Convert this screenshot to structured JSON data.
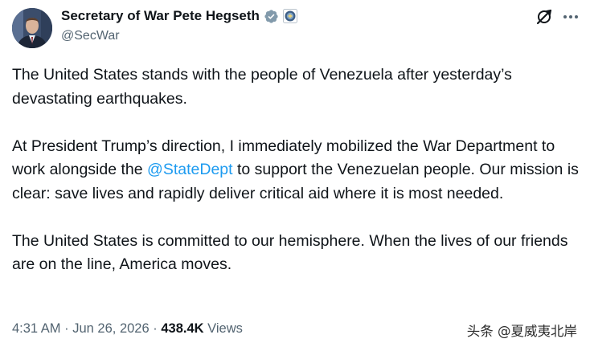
{
  "author": {
    "display_name": "Secretary of War Pete Hegseth",
    "handle": "@SecWar",
    "verified_badge": "gray-checkmark-icon",
    "affiliate_badge": "department-seal-icon"
  },
  "actions": {
    "grok_icon": "grok-icon",
    "more_icon": "more-horizontal-icon"
  },
  "body": {
    "p1": "The United States stands with the people of Venezuela after yesterday’s devastating earthquakes.",
    "p2_before": "At President Trump’s direction, I immediately mobilized the War Department to work alongside the ",
    "p2_mention": "@StateDept",
    "p2_after": " to support the Venezuelan people. Our mission is clear: save lives and rapidly deliver critical aid where it is most needed.",
    "p3": "The United States is committed to our hemisphere. When the lives of our friends are on the line, America moves."
  },
  "meta": {
    "time": "4:31 AM",
    "separator": "·",
    "date": "Jun 26, 2026",
    "views_count": "438.4K",
    "views_label": "Views"
  },
  "watermark": "头条 @夏威夷北岸",
  "colors": {
    "text": "#0f1419",
    "secondary": "#536471",
    "link": "#1d9bf0",
    "verified": "#829aab"
  }
}
